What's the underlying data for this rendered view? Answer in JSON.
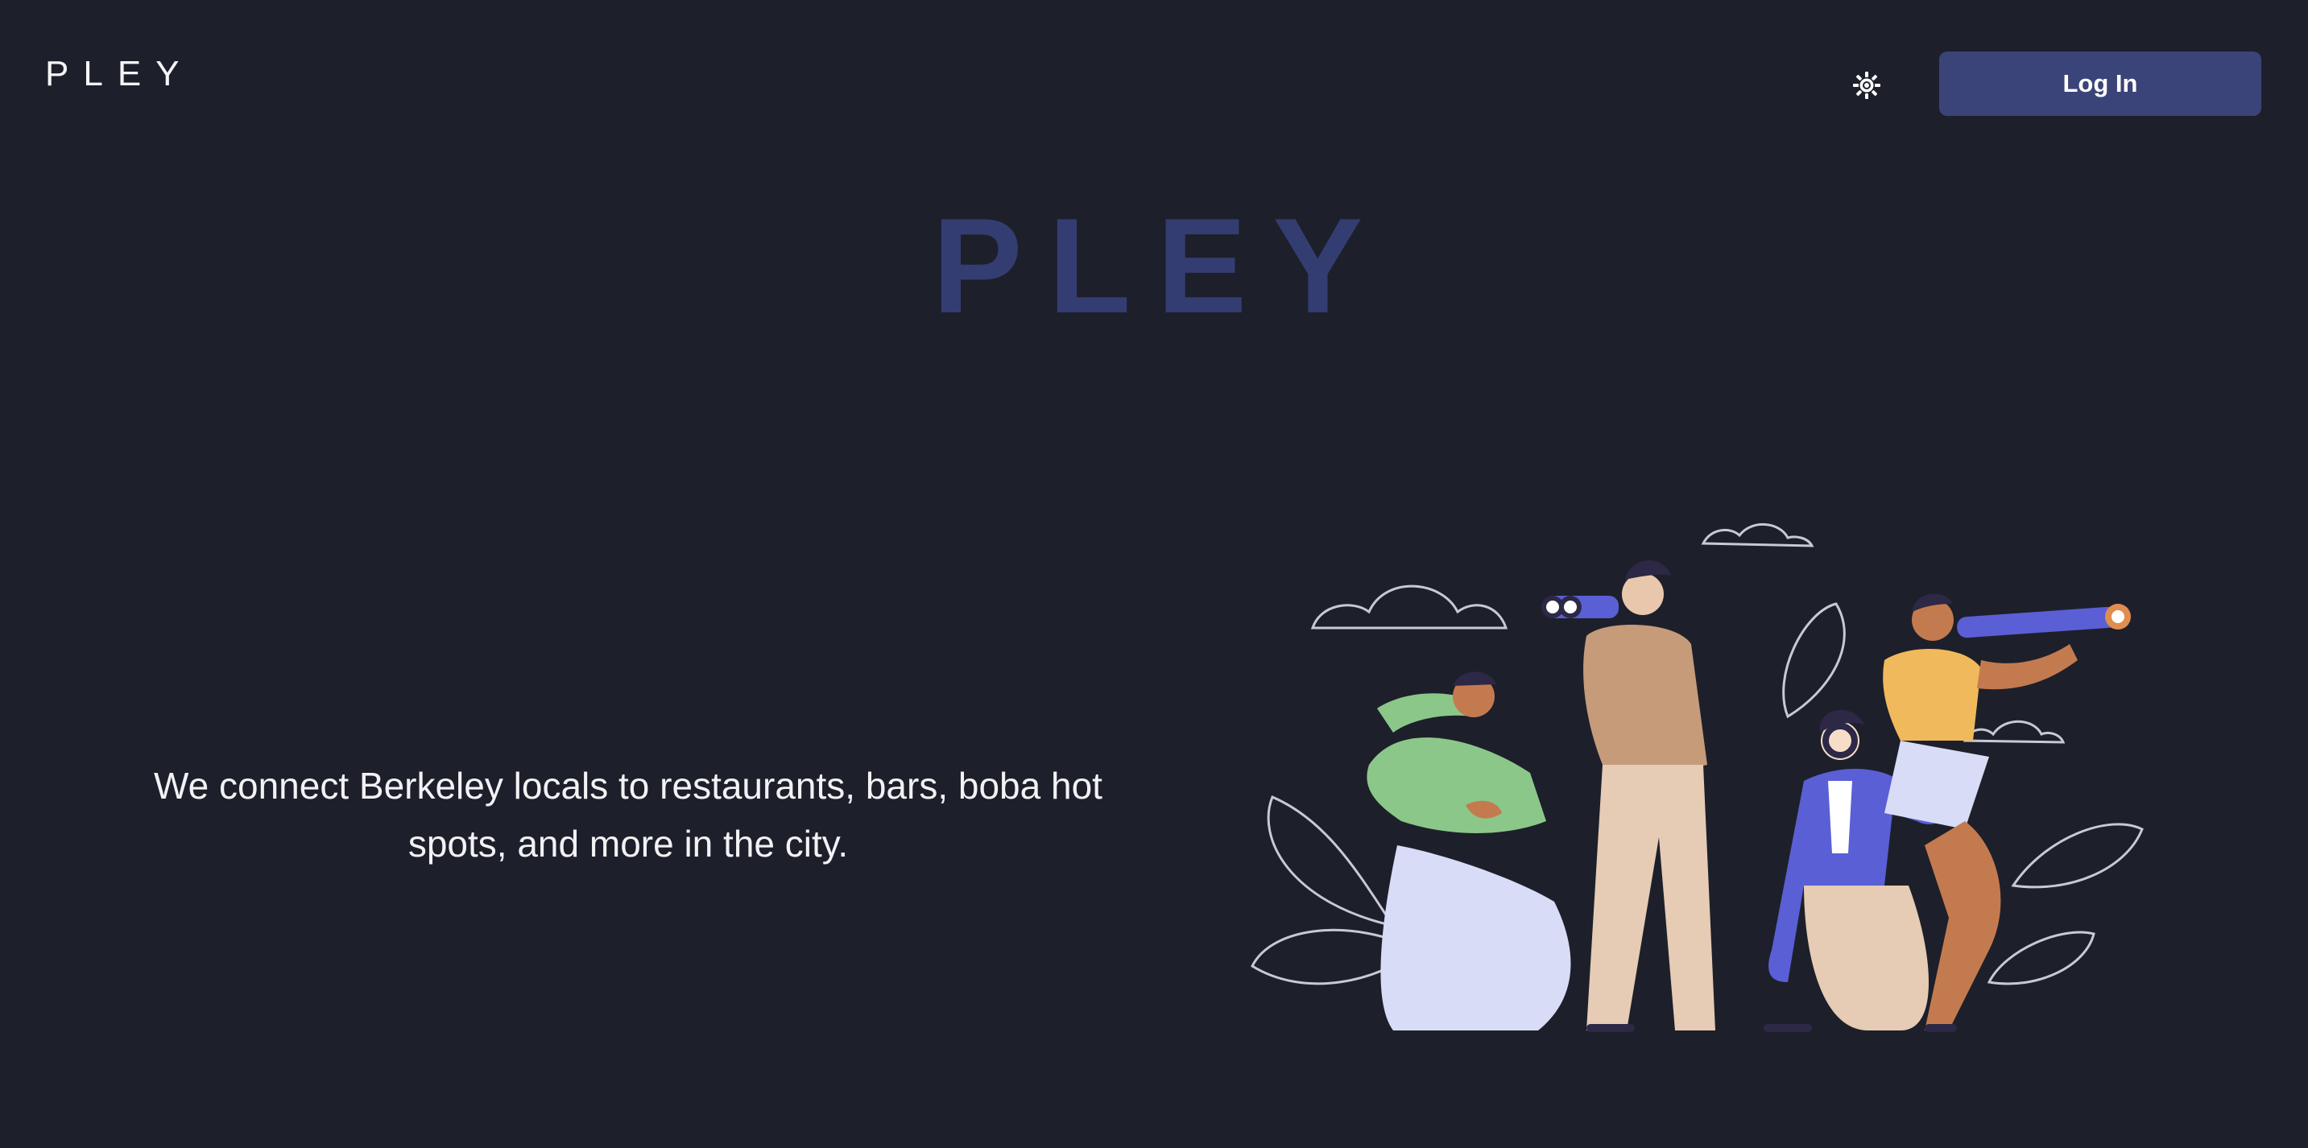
{
  "header": {
    "logo_text": "PLEY",
    "theme_toggle_icon": "sun-icon",
    "login_label": "Log In"
  },
  "hero": {
    "title": "PLEY",
    "tagline": "We connect Berkeley locals to restaurants, bars, boba hot spots, and more in the city."
  },
  "colors": {
    "background": "#1d202a",
    "accent": "#3b4478",
    "hero_title": "#343d72",
    "text": "#f2f2f5"
  },
  "illustration": {
    "description_icon": "people-exploring-illustration"
  }
}
